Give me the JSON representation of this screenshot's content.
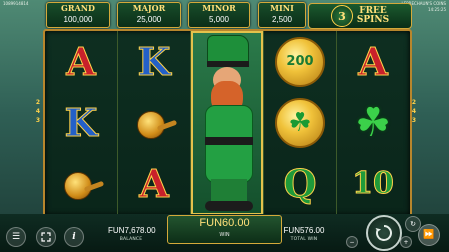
{
  "top": {
    "game_id": "1089914814",
    "title": "LEPRECHAUN'S COINS",
    "time": "14:25:25"
  },
  "jackpots": {
    "grand": {
      "name": "GRAND",
      "value": "100,000"
    },
    "major": {
      "name": "MAJOR",
      "value": "25,000"
    },
    "minor": {
      "name": "MINOR",
      "value": "5,000"
    },
    "mini": {
      "name": "MINI",
      "value": "2,500"
    }
  },
  "free_spins": {
    "count": "3",
    "line1": "FREE",
    "line2": "SPINS"
  },
  "paylines": {
    "left": [
      "2",
      "4",
      "3"
    ],
    "right": [
      "2",
      "4",
      "3"
    ]
  },
  "reels": {
    "reel1": [
      {
        "type": "letter",
        "text": "A"
      },
      {
        "type": "letter",
        "text": "K"
      },
      {
        "type": "pipe"
      }
    ],
    "reel2": [
      {
        "type": "letter",
        "text": "K"
      },
      {
        "type": "pipe"
      },
      {
        "type": "letter",
        "text": "A"
      }
    ],
    "reel3": [
      {
        "type": "leprechaun"
      }
    ],
    "reel4": [
      {
        "type": "coin",
        "text": "200"
      },
      {
        "type": "clover-coin",
        "text": "☘"
      },
      {
        "type": "letter",
        "text": "Q"
      }
    ],
    "reel5": [
      {
        "type": "letter",
        "text": "A"
      },
      {
        "type": "clover",
        "text": "☘"
      },
      {
        "type": "letter",
        "text": "10"
      }
    ]
  },
  "bottom": {
    "balance": {
      "value": "FUN7,678.00",
      "label": "BALANCE"
    },
    "win": {
      "value": "FUN60.00",
      "label": "WIN"
    },
    "total_win": {
      "value": "FUN576.00",
      "label": "TOTAL WIN"
    }
  },
  "icons": {
    "menu": "menu-icon",
    "fullscreen": "fullscreen-icon",
    "info": "info-icon",
    "spin": "spin-icon",
    "autoplay": "autoplay-icon",
    "turbo": "fast-forward-icon"
  },
  "colors": {
    "gold": "#d4a93a",
    "jackpot_text": "#ffe07a",
    "reel_bg": "#0e2f21"
  }
}
